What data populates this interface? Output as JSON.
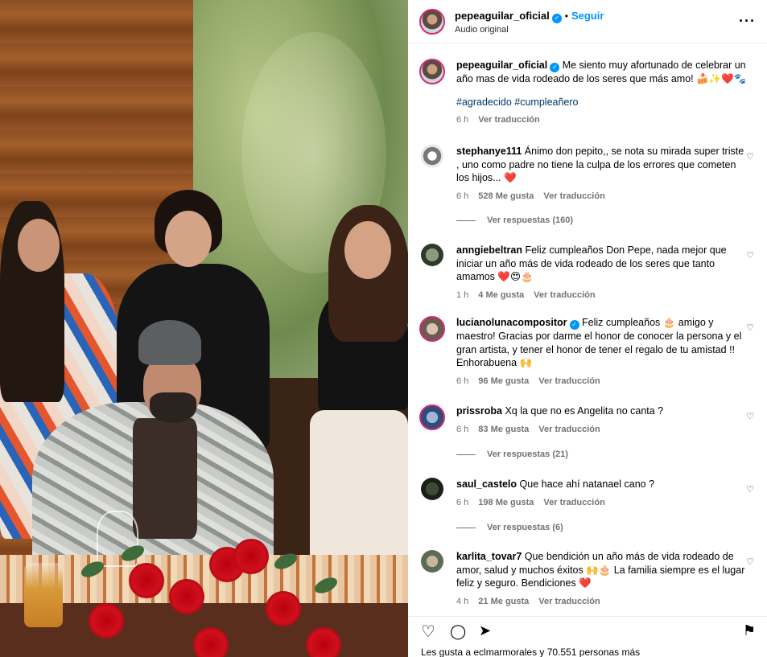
{
  "header": {
    "username": "pepeaguilar_oficial",
    "follow_label": "Seguir",
    "dot": "•",
    "subtitle": "Audio original",
    "more": "···"
  },
  "caption": {
    "username": "pepeaguilar_oficial",
    "text": "Me siento muy afortunado de celebrar un año mas de vida rodeado de los seres que más amo! 🍰✨❤️🐾",
    "hashtags": "#agradecido #cumpleañero",
    "time": "6 h",
    "translate": "Ver traducción"
  },
  "comments": [
    {
      "username": "stephanye111",
      "text": "Ánimo don pepito,, se nota su mirada super triste , uno como padre no tiene la culpa de los errores que cometen los hijos... ❤️",
      "time": "6 h",
      "likes": "528 Me gusta",
      "translate": "Ver traducción",
      "replies": "Ver respuestas (160)"
    },
    {
      "username": "anngiebeltran",
      "text": "Feliz cumpleaños Don Pepe, nada mejor que iniciar un año más de vida rodeado de los seres que tanto amamos ❤️😍🎂",
      "time": "1 h",
      "likes": "4 Me gusta",
      "translate": "Ver traducción",
      "replies": ""
    },
    {
      "username": "lucianolunacompositor",
      "text": "Feliz cumpleaños 🎂 amigo y maestro! Gracias por darme el honor de conocer la persona y el gran artista, y tener el honor de tener el regalo de tu amistad !! Enhorabuena 🙌",
      "time": "6 h",
      "likes": "96 Me gusta",
      "translate": "Ver traducción",
      "replies": ""
    },
    {
      "username": "prissroba",
      "text": "Xq la que no es Angelita no canta ?",
      "time": "6 h",
      "likes": "83 Me gusta",
      "translate": "Ver traducción",
      "replies": "Ver respuestas (21)"
    },
    {
      "username": "saul_castelo",
      "text": "Que hace ahí natanael cano ?",
      "time": "6 h",
      "likes": "198 Me gusta",
      "translate": "Ver traducción",
      "replies": "Ver respuestas (6)"
    },
    {
      "username": "karlita_tovar7",
      "text": "Que bendición un año más de vida rodeado de amor, salud y muchos éxitos 🙌🎂 La familia siempre es el lugar feliz y seguro. Bendiciones ❤️",
      "time": "4 h",
      "likes": "21 Me gusta",
      "translate": "Ver traducción",
      "replies": ""
    }
  ],
  "actions": {
    "like": "♡",
    "comment": "◯",
    "share": "➤",
    "save": "⚑"
  },
  "likes_line": "Les gusta a eclmarmorales y 70.551 personas más",
  "colors": {
    "accent": "#0095f6",
    "ring": "#d62976",
    "muted": "#737373"
  }
}
